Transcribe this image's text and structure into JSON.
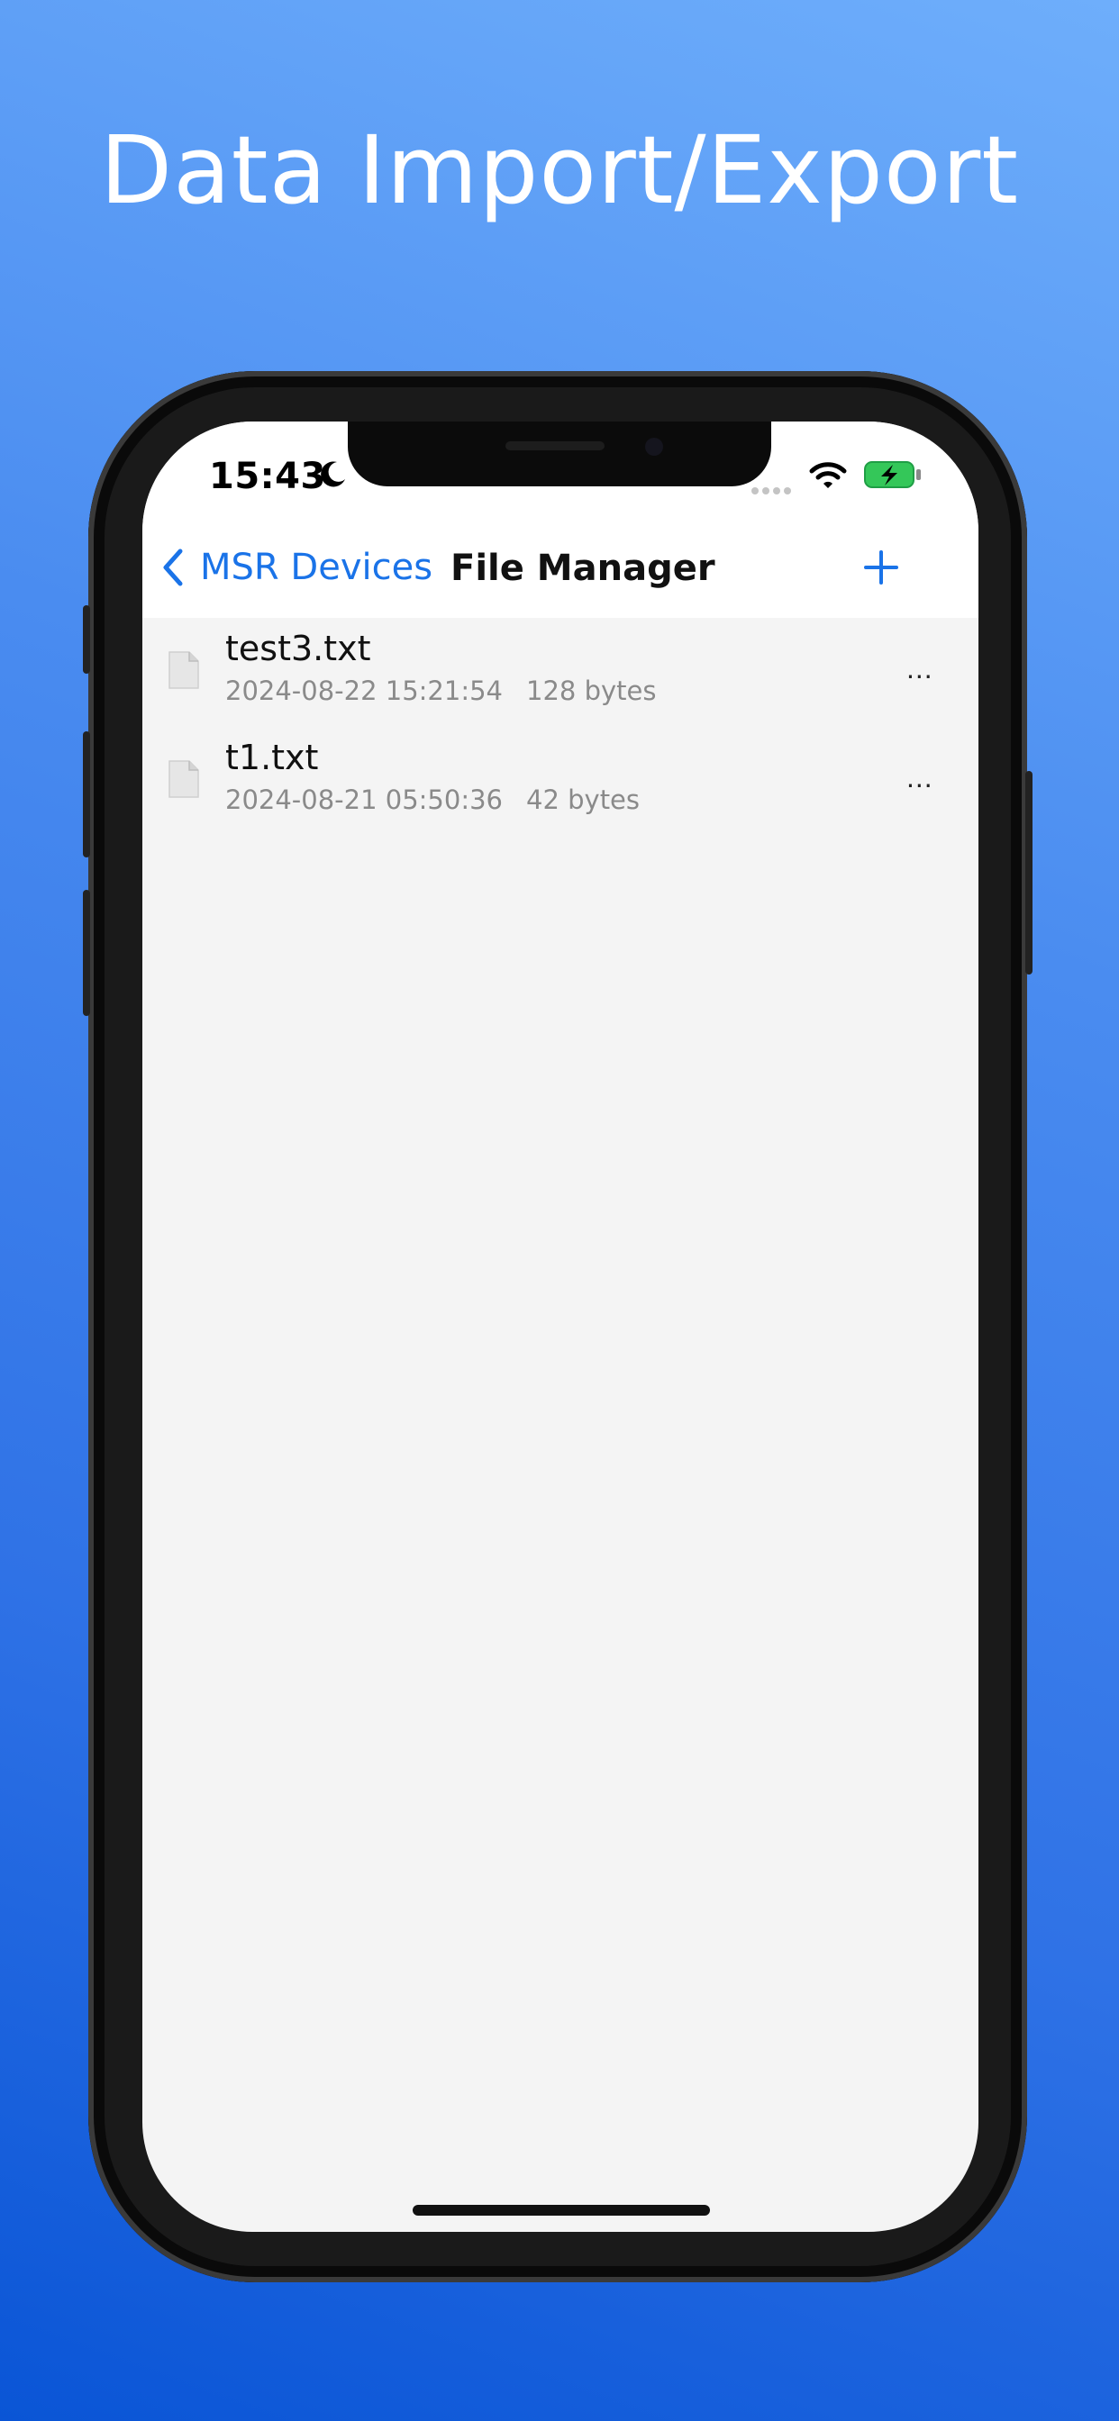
{
  "headline": "Data Import/Export",
  "status_bar": {
    "time": "15:43"
  },
  "nav": {
    "back_label": "MSR Devices",
    "title": "File Manager"
  },
  "files": [
    {
      "name": "test3.txt",
      "date": "2024-08-22 15:21:54",
      "size": "128 bytes",
      "more": "..."
    },
    {
      "name": "t1.txt",
      "date": "2024-08-21 05:50:36",
      "size": "42 bytes",
      "more": "..."
    }
  ],
  "colors": {
    "accent": "#1a73e8",
    "battery_green": "#34c759",
    "background_top": "#6eaefb",
    "background_bottom": "#0a55d6"
  }
}
